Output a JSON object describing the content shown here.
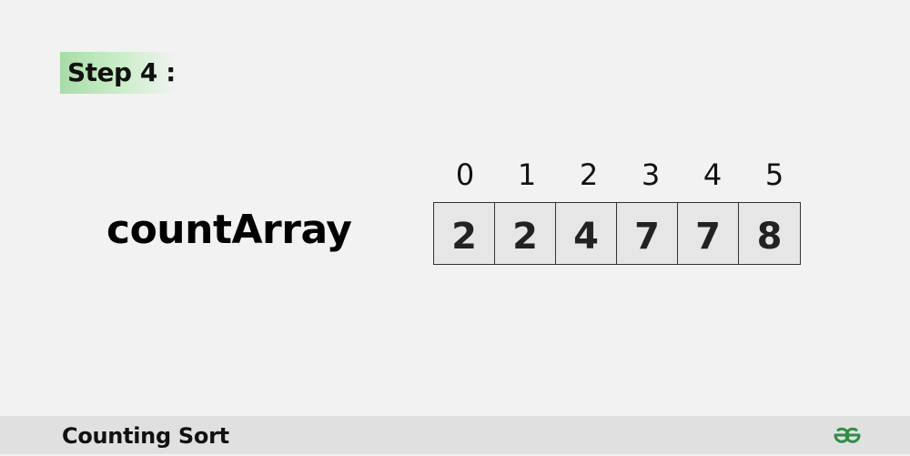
{
  "step": {
    "label": "Step 4 :"
  },
  "array": {
    "name": "countArray",
    "indices": [
      "0",
      "1",
      "2",
      "3",
      "4",
      "5"
    ],
    "values": [
      "2",
      "2",
      "4",
      "7",
      "7",
      "8"
    ]
  },
  "footer": {
    "title": "Counting Sort",
    "logo_icon": "gfg-logo-icon",
    "logo_color": "#2f8d46"
  },
  "colors": {
    "badge": "#a8dca8",
    "cell_fill": "#e6e6e6",
    "footer_bg": "#e0e0e0"
  }
}
